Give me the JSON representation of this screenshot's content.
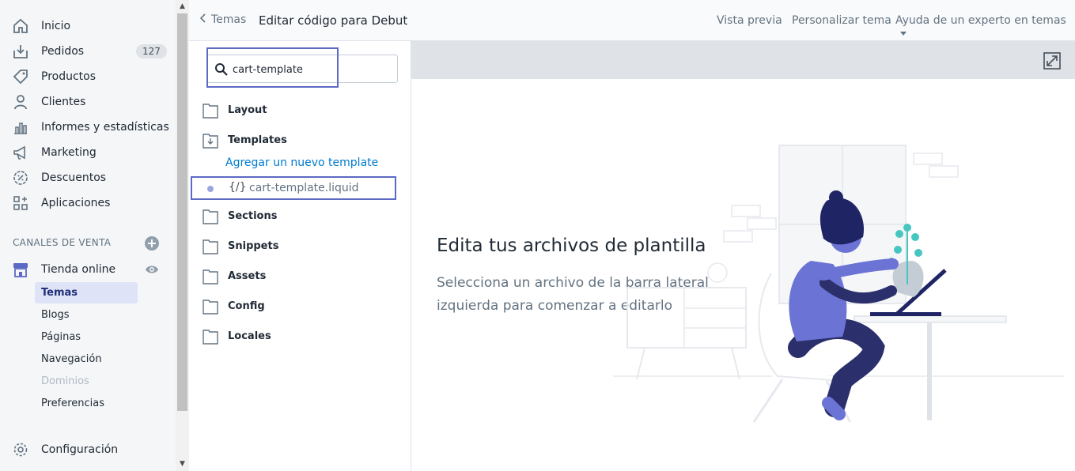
{
  "sidebar": {
    "items": [
      {
        "label": "Inicio",
        "icon": "home-icon"
      },
      {
        "label": "Pedidos",
        "icon": "orders-icon",
        "badge": "127"
      },
      {
        "label": "Productos",
        "icon": "tag-icon"
      },
      {
        "label": "Clientes",
        "icon": "user-icon"
      },
      {
        "label": "Informes y estadísticas",
        "icon": "bar-chart-icon"
      },
      {
        "label": "Marketing",
        "icon": "megaphone-icon"
      },
      {
        "label": "Descuentos",
        "icon": "discount-icon"
      },
      {
        "label": "Aplicaciones",
        "icon": "apps-icon"
      }
    ],
    "sales_channels_heading": "CANALES DE VENTA",
    "online_store": {
      "label": "Tienda online"
    },
    "sub_items": [
      {
        "label": "Temas",
        "state": "active"
      },
      {
        "label": "Blogs",
        "state": "normal"
      },
      {
        "label": "Páginas",
        "state": "normal"
      },
      {
        "label": "Navegación",
        "state": "normal"
      },
      {
        "label": "Dominios",
        "state": "disabled"
      },
      {
        "label": "Preferencias",
        "state": "normal"
      }
    ],
    "settings_label": "Configuración"
  },
  "topbar": {
    "back_label": "Temas",
    "title": "Editar código para Debut",
    "preview_label": "Vista previa",
    "customize_label": "Personalizar tema",
    "expert_help_label": "Ayuda de un experto en temas"
  },
  "file_panel": {
    "search_value": "cart-template",
    "folders": [
      "Layout",
      "Templates",
      "Sections",
      "Snippets",
      "Assets",
      "Config",
      "Locales"
    ],
    "add_template_label": "Agregar un nuevo template",
    "file_code_glyph": "{/}",
    "file_name": "cart-template.liquid"
  },
  "editor": {
    "empty_title": "Edita tus archivos de plantilla",
    "empty_subtitle_line1": "Selecciona un archivo de la barra lateral",
    "empty_subtitle_line2": "izquierda para comenzar a editarlo"
  },
  "colors": {
    "accent": "#5c6ac4",
    "link": "#007ace",
    "active_bg": "#dfe3f7"
  }
}
